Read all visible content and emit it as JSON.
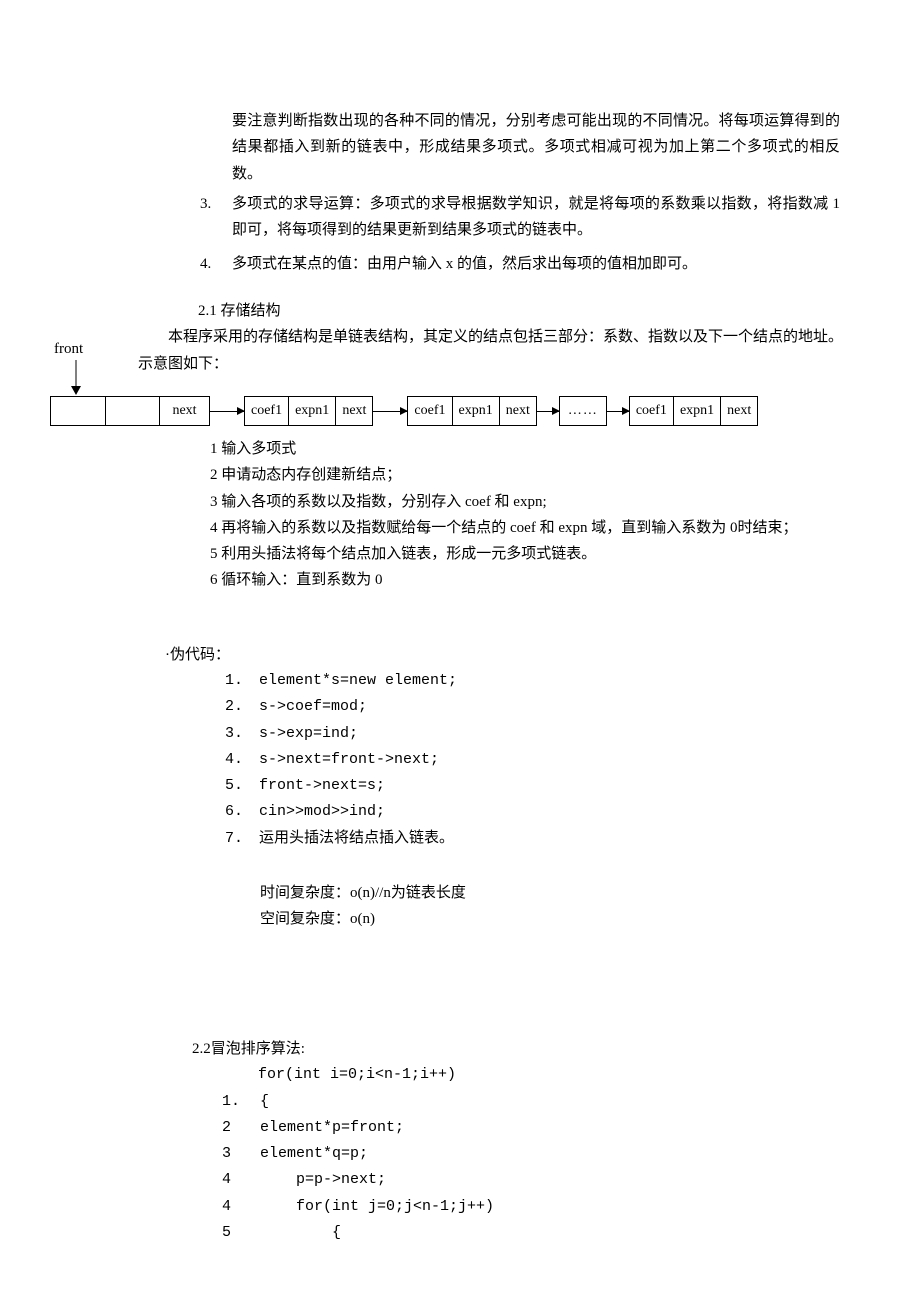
{
  "intro": {
    "continuation": "要注意判断指数出现的各种不同的情况，分别考虑可能出现的不同情况。将每项运算得到的结果都插入到新的链表中，形成结果多项式。多项式相减可视为加上第二个多项式的相反数。",
    "item3_num": "3.",
    "item3": "多项式的求导运算：多项式的求导根据数学知识，就是将每项的系数乘以指数，将指数减 1 即可，将每项得到的结果更新到结果多项式的链表中。",
    "item4_num": "4.",
    "item4": "多项式在某点的值：由用户输入 x 的值，然后求出每项的值相加即可。"
  },
  "storage": {
    "heading": "2.1 存储结构",
    "p1": "本程序采用的存储结构是单链表结构，其定义的结点包括三部分：系数、指数以及下一个结点的地址。",
    "p2": "示意图如下："
  },
  "front_label": "front",
  "node_labels": {
    "next": "next",
    "coef": "coef1",
    "expn": "expn1",
    "dots": "……"
  },
  "steps": {
    "s1": "1 输入多项式",
    "s2": "2 申请动态内存创建新结点；",
    "s3": "3 输入各项的系数以及指数，分别存入 coef 和 expn;",
    "s4": "4 再将输入的系数以及指数赋给每一个结点的 coef 和 expn 域，直到输入系数为 0时结束；",
    "s5": "5 利用头插法将每个结点加入链表，形成一元多项式链表。",
    "s6": "6 循环输入：直到系数为 0"
  },
  "pseudo": {
    "label": "·伪代码：",
    "lines": [
      {
        "n": "1.",
        "c": "element*s=new element;"
      },
      {
        "n": "2.",
        "c": "s->coef=mod;"
      },
      {
        "n": "3.",
        "c": "s->exp=ind;"
      },
      {
        "n": "4.",
        "c": "s->next=front->next;"
      },
      {
        "n": "5.",
        "c": "front->next=s;"
      },
      {
        "n": "6.",
        "c": "cin>>mod>>ind;"
      },
      {
        "n": "7.",
        "c": "运用头插法将结点插入链表。"
      }
    ],
    "time": "时间复杂度：o(n)//n为链表长度",
    "space": "空间复杂度：o(n)"
  },
  "bubble": {
    "heading": "2.2冒泡排序算法:",
    "for_line": "for(int i=0;i<n-1;i++)",
    "lines": [
      {
        "n": "1.",
        "c": "{"
      },
      {
        "n": "2",
        "c": "element*p=front;"
      },
      {
        "n": "3",
        "c": "element*q=p;"
      },
      {
        "n": "4",
        "c": "    p=p->next;"
      },
      {
        "n": "4",
        "c": "    for(int j=0;j<n-1;j++)"
      },
      {
        "n": "5",
        "c": "        {"
      }
    ]
  }
}
